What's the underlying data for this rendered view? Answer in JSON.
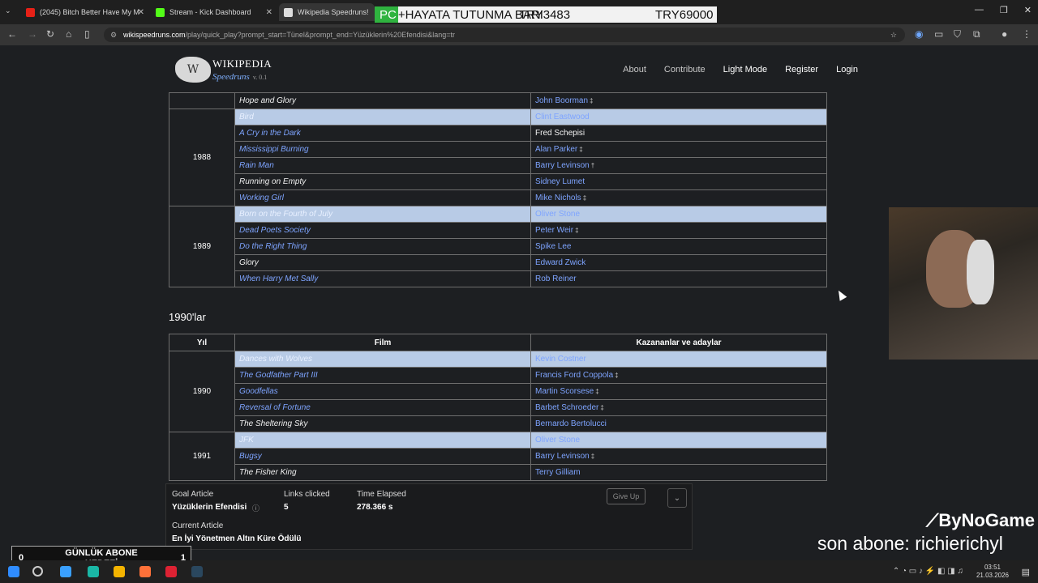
{
  "browser": {
    "tabs": [
      {
        "label": "(2045) Bitch Better Have My M",
        "color": "#e62117"
      },
      {
        "label": "Stream - Kick Dashboard",
        "color": "#53fc18"
      },
      {
        "label": "Wikipedia Speedruns!",
        "color": "#dddddd"
      }
    ],
    "url_host": "wikispeedruns.com",
    "url_path": "/play/quick_play?prompt_start=Tünel&prompt_end=Yüzüklerin%20Efendisi&lang=tr"
  },
  "stream_banner": {
    "prefix": "PC",
    "text": "+HAYATA TUTUNMA BARI",
    "amount1": "TRY3483",
    "amount2": "TRY69000"
  },
  "site": {
    "logo_line1": "WIKIPEDIA",
    "logo_line2": "Speedruns",
    "version": "v. 0.1",
    "nav": [
      "About",
      "Contribute",
      "Light Mode",
      "Register",
      "Login"
    ]
  },
  "table80s": {
    "rows": [
      {
        "year": "",
        "film": "Hope and Glory",
        "film_link": false,
        "winner": "John Boorman",
        "winner_mark": "‡",
        "hl": false
      },
      {
        "year": "1988",
        "film": "Bird",
        "film_link": true,
        "winner": "Clint Eastwood",
        "winner_mark": "",
        "hl": true
      },
      {
        "year": "",
        "film": "A Cry in the Dark",
        "film_link": true,
        "winner": "Fred Schepisi",
        "winner_mark": "",
        "hl": false,
        "winner_plain": true
      },
      {
        "year": "",
        "film": "Mississippi Burning",
        "film_link": true,
        "winner": "Alan Parker",
        "winner_mark": "‡",
        "hl": false
      },
      {
        "year": "",
        "film": "Rain Man",
        "film_link": true,
        "winner": "Barry Levinson",
        "winner_mark": "†",
        "hl": false
      },
      {
        "year": "",
        "film": "Running on Empty",
        "film_link": false,
        "winner": "Sidney Lumet",
        "winner_mark": "",
        "hl": false
      },
      {
        "year": "",
        "film": "Working Girl",
        "film_link": true,
        "winner": "Mike Nichols",
        "winner_mark": "‡",
        "hl": false
      },
      {
        "year": "1989",
        "film": "Born on the Fourth of July",
        "film_link": true,
        "winner": "Oliver Stone",
        "winner_mark": "",
        "hl": true
      },
      {
        "year": "",
        "film": "Dead Poets Society",
        "film_link": true,
        "winner": "Peter Weir",
        "winner_mark": "‡",
        "hl": false
      },
      {
        "year": "",
        "film": "Do the Right Thing",
        "film_link": true,
        "winner": "Spike Lee",
        "winner_mark": "",
        "hl": false
      },
      {
        "year": "",
        "film": "Glory",
        "film_link": false,
        "winner": "Edward Zwick",
        "winner_mark": "",
        "hl": false
      },
      {
        "year": "",
        "film": "When Harry Met Sally",
        "film_link": true,
        "winner": "Rob Reiner",
        "winner_mark": "",
        "hl": false
      }
    ]
  },
  "section_1990s": "1990'lar",
  "table90s": {
    "headers": [
      "Yıl",
      "Film",
      "Kazananlar ve adaylar"
    ],
    "rows": [
      {
        "year": "1990",
        "film": "Dances with Wolves",
        "film_link": true,
        "winner": "Kevin Costner",
        "winner_mark": "",
        "hl": true
      },
      {
        "year": "",
        "film": "The Godfather Part III",
        "film_link": true,
        "winner": "Francis Ford Coppola",
        "winner_mark": "‡",
        "hl": false
      },
      {
        "year": "",
        "film": "Goodfellas",
        "film_link": true,
        "winner": "Martin Scorsese",
        "winner_mark": "‡",
        "hl": false
      },
      {
        "year": "",
        "film": "Reversal of Fortune",
        "film_link": true,
        "winner": "Barbet Schroeder",
        "winner_mark": "‡",
        "hl": false
      },
      {
        "year": "",
        "film": "The Sheltering Sky",
        "film_link": false,
        "winner": "Bernardo Bertolucci",
        "winner_mark": "",
        "hl": false
      },
      {
        "year": "1991",
        "film": "JFK",
        "film_link": true,
        "winner": "Oliver Stone",
        "winner_mark": "",
        "hl": true
      },
      {
        "year": "",
        "film": "Bugsy",
        "film_link": true,
        "winner": "Barry Levinson",
        "winner_mark": "‡",
        "hl": false
      },
      {
        "year": "",
        "film": "The Fisher King",
        "film_link": false,
        "winner": "Terry Gilliam",
        "winner_mark": "",
        "hl": false
      }
    ]
  },
  "game": {
    "goal_label": "Goal Article",
    "goal_value": "Yüzüklerin Efendisi",
    "links_label": "Links clicked",
    "links_value": "5",
    "time_label": "Time Elapsed",
    "time_value": "278.366 s",
    "current_label": "Current Article",
    "current_value": "En İyi Yönetmen Altın Küre Ödülü",
    "give_up": "Give Up"
  },
  "stream": {
    "brand": "ByNoGame",
    "last_sub": "son abone: richierichyl",
    "goal_title": "GÜNLÜK ABONE HEDEFİ",
    "goal_left": "0",
    "goal_right": "1"
  },
  "taskbar": {
    "time": "03:51",
    "date": "21.03.2026"
  }
}
